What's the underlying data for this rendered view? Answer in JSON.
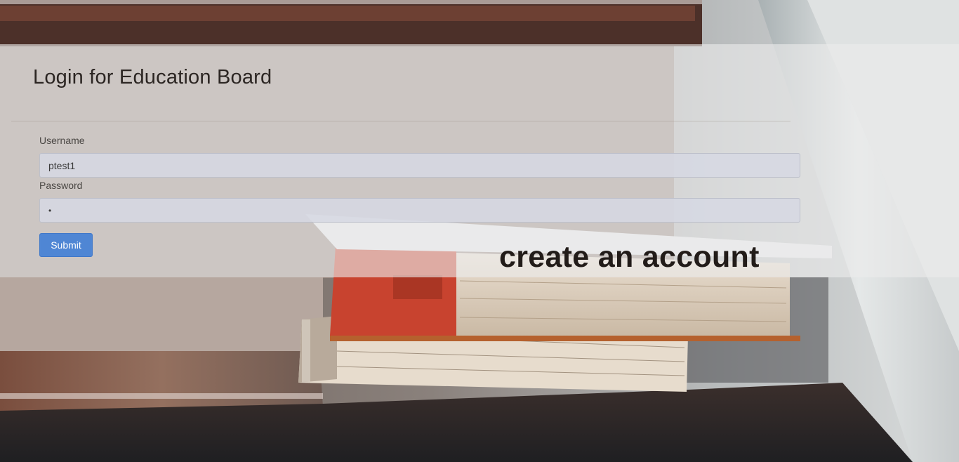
{
  "page": {
    "title": "Login for Education Board"
  },
  "form": {
    "username_label": "Username",
    "username_value": "ptest1",
    "password_label": "Password",
    "password_value": "•",
    "submit_label": "Submit"
  },
  "links": {
    "create_account": "create an account"
  },
  "colors": {
    "submit_button": "#4f86d4",
    "panel_overlay": "#ececec",
    "title_text": "#2c2623"
  }
}
